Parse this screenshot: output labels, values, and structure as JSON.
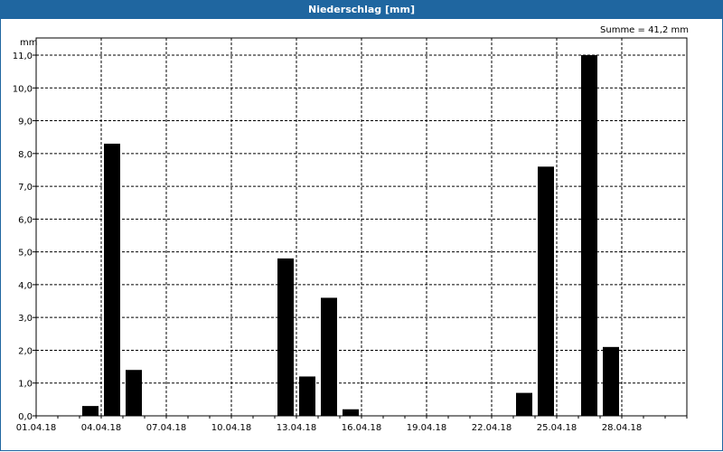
{
  "window": {
    "title": "Niederschlag [mm]"
  },
  "chart_data": {
    "type": "bar",
    "title": "Niederschlag [mm]",
    "ylabel": "mm",
    "annotation": "Summe = 41,2 mm",
    "ylim": [
      0,
      11.0
    ],
    "y_ticks": [
      "0,0",
      "1,0",
      "2,0",
      "3,0",
      "4,0",
      "5,0",
      "6,0",
      "7,0",
      "8,0",
      "9,0",
      "10,0",
      "11,0"
    ],
    "x_ticks": [
      "01.04.18",
      "04.04.18",
      "07.04.18",
      "10.04.18",
      "13.04.18",
      "16.04.18",
      "19.04.18",
      "22.04.18",
      "25.04.18",
      "28.04.18"
    ],
    "grid": true,
    "categories": [
      "01.04.18",
      "02.04.18",
      "03.04.18",
      "04.04.18",
      "05.04.18",
      "06.04.18",
      "07.04.18",
      "08.04.18",
      "09.04.18",
      "10.04.18",
      "11.04.18",
      "12.04.18",
      "13.04.18",
      "14.04.18",
      "15.04.18",
      "16.04.18",
      "17.04.18",
      "18.04.18",
      "19.04.18",
      "20.04.18",
      "21.04.18",
      "22.04.18",
      "23.04.18",
      "24.04.18",
      "25.04.18",
      "26.04.18",
      "27.04.18",
      "28.04.18",
      "29.04.18",
      "30.04.18"
    ],
    "values": [
      0,
      0,
      0.3,
      8.3,
      1.4,
      0,
      0,
      0,
      0,
      0,
      0,
      4.8,
      1.2,
      3.6,
      0.2,
      0,
      0,
      0,
      0,
      0,
      0,
      0,
      0.7,
      7.6,
      0,
      11.0,
      2.1,
      0,
      0,
      0
    ],
    "color": "#000000"
  }
}
